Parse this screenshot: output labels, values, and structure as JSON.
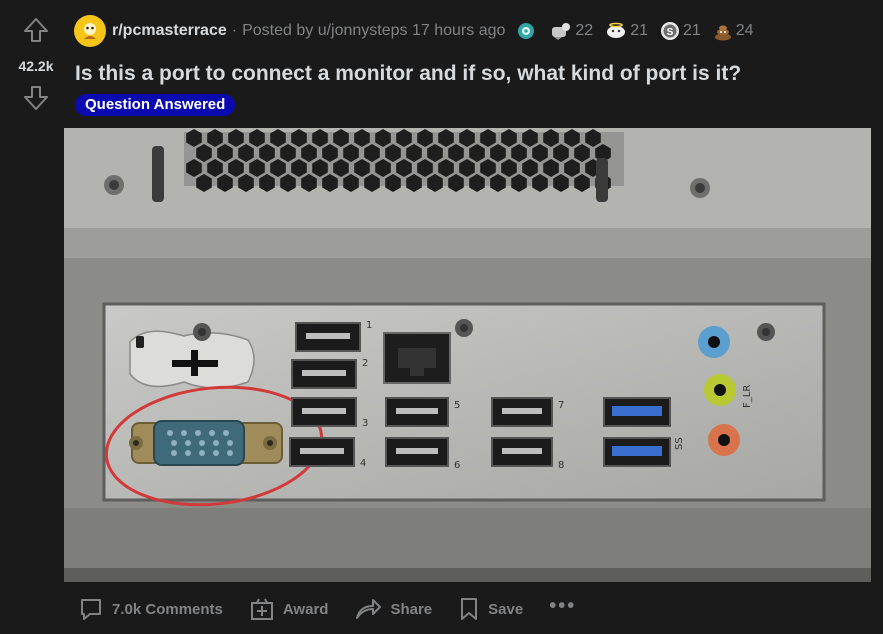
{
  "vote": {
    "count": "42.2k"
  },
  "post": {
    "subreddit": "r/pcmasterrace",
    "separator": "·",
    "posted_by_prefix": "Posted by",
    "author": "u/jonnysteps",
    "time_ago": "17 hours ago",
    "title": "Is this a port to connect a monitor and if so, what kind of port is it?",
    "flair": "Question Answered",
    "awards": [
      {
        "icon": "helpful-award-icon",
        "count": ""
      },
      {
        "icon": "wholesome-award-icon",
        "count": "22"
      },
      {
        "icon": "bless-award-icon",
        "count": "21"
      },
      {
        "icon": "silver-award-icon",
        "count": "21"
      },
      {
        "icon": "poop-award-icon",
        "count": "24"
      }
    ]
  },
  "image": {
    "port_labels": [
      "1",
      "2",
      "3",
      "4",
      "5",
      "6",
      "7",
      "8"
    ],
    "audio_label": "F_LR",
    "ss_label": "SS"
  },
  "actions": {
    "comments": "7.0k Comments",
    "award": "Award",
    "share": "Share",
    "save": "Save",
    "more": "•••"
  },
  "colors": {
    "background": "#1a1a1b",
    "text": "#d7dadc",
    "muted": "#818384",
    "flair_bg": "#0a0ab0"
  }
}
